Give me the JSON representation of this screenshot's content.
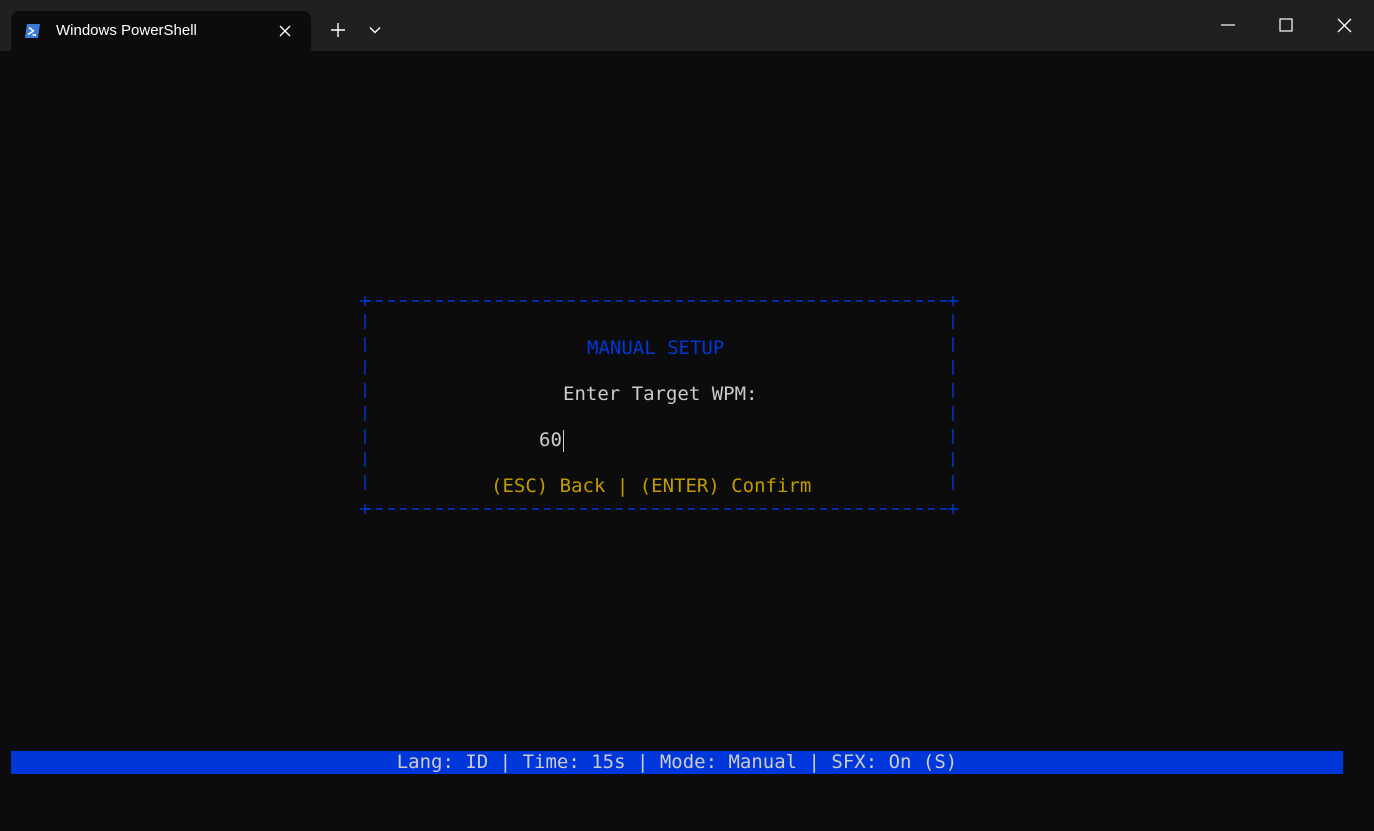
{
  "window": {
    "tab_title": "Windows PowerShell",
    "tab_icon": "powershell-icon",
    "new_tab_icon": "plus-icon",
    "dropdown_icon": "chevron-down-icon",
    "close_tab_icon": "close-icon",
    "minimize_icon": "minimize-icon",
    "maximize_icon": "maximize-icon",
    "close_icon": "close-icon"
  },
  "dialog": {
    "title": "MANUAL SETUP",
    "prompt": "Enter Target WPM:",
    "input_value": "60",
    "hints": "(ESC) Back | (ENTER) Confirm"
  },
  "status_bar": {
    "text": "Lang: ID | Time: 15s | Mode: Manual | SFX: On (S)"
  },
  "colors": {
    "terminal_bg": "#0c0c0c",
    "titlebar_bg": "#202020",
    "accent_blue": "#0037da",
    "hint_yellow": "#c19c00",
    "text_gray": "#cccccc"
  }
}
